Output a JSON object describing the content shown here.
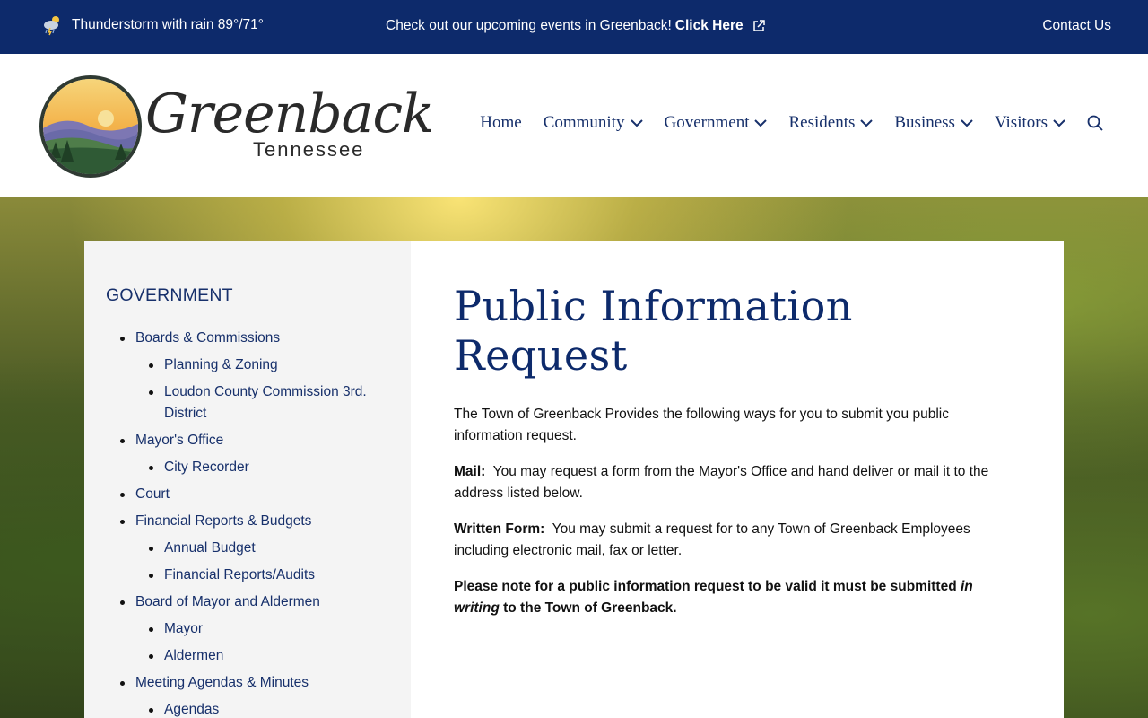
{
  "topbar": {
    "weather": "Thunderstorm with rain 89°/71°",
    "announce_text": "Check out our upcoming events in Greenback!",
    "announce_link": "Click Here",
    "contact": "Contact Us"
  },
  "logo": {
    "word": "Greenback",
    "sub": "Tennessee"
  },
  "nav": {
    "items": [
      {
        "label": "Home"
      },
      {
        "label": "Community"
      },
      {
        "label": "Government"
      },
      {
        "label": "Residents"
      },
      {
        "label": "Business"
      },
      {
        "label": "Visitors"
      }
    ]
  },
  "sidebar": {
    "title": "GOVERNMENT",
    "items": [
      {
        "label": "Boards & Commissions"
      },
      {
        "label": "Planning & Zoning"
      },
      {
        "label": "Loudon County Commission 3rd. District"
      },
      {
        "label": "Mayor's Office"
      },
      {
        "label": "City Recorder"
      },
      {
        "label": "Court"
      },
      {
        "label": "Financial Reports & Budgets"
      },
      {
        "label": "Annual Budget"
      },
      {
        "label": "Financial Reports/Audits"
      },
      {
        "label": "Board of Mayor and Aldermen"
      },
      {
        "label": "Mayor"
      },
      {
        "label": "Aldermen"
      },
      {
        "label": "Meeting Agendas & Minutes"
      },
      {
        "label": "Agendas"
      }
    ]
  },
  "main": {
    "title": "Public Information Request",
    "intro": "The Town of Greenback Provides the following ways for you to submit you public information request.",
    "mail_label": "Mail:",
    "mail_text": "You may request a form from the Mayor's Office and hand deliver or mail it to the address listed below.",
    "written_label": "Written Form:",
    "written_text": "You may submit a request for to any Town of Greenback Employees including electronic mail, fax or letter.",
    "note_a": "Please note for a public information request to be valid it must be submitted",
    "note_italic": "in writing",
    "note_b": "to the Town of Greenback."
  }
}
